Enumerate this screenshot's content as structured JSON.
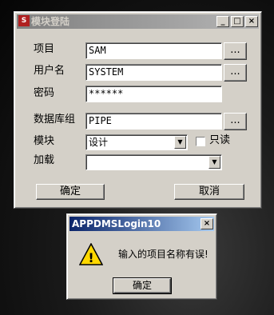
{
  "main": {
    "title": "模块登陆",
    "app_icon": "S",
    "controls": {
      "minimize": "_",
      "maximize": "□",
      "close": "×"
    },
    "fields": [
      {
        "label": "项目",
        "value": "SAM"
      },
      {
        "label": "用户名",
        "value": "SYSTEM"
      },
      {
        "label": "密码",
        "value": "******"
      },
      {
        "label": "数据库组",
        "value": "PIPE"
      }
    ],
    "browse_label": "...",
    "module": {
      "label": "模块",
      "value": "设计"
    },
    "readonly_label": "只读",
    "load": {
      "label": "加载",
      "value": ""
    },
    "ok_label": "确定",
    "cancel_label": "取消"
  },
  "alert": {
    "title": "APPDMSLogin10",
    "close": "×",
    "message": "输入的项目名称有误!",
    "icon_glyph": "!",
    "ok_label": "确定"
  }
}
